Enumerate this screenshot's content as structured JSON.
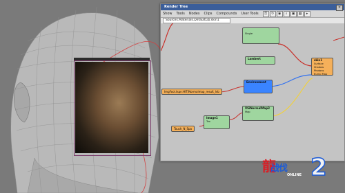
{
  "window": {
    "title": "Render Tree",
    "close_glyph": "×",
    "menus": [
      "Show",
      "Tools",
      "Nodes",
      "Clips",
      "Compounds",
      "User Tools"
    ],
    "path": "Sources.Materials.DefaultLib.skin1"
  },
  "nodes": {
    "top": {
      "label": "",
      "sub": "Single"
    },
    "lambert": {
      "label": "Lambert"
    },
    "environment": {
      "label": "Environment"
    },
    "phong_map": {
      "label": "XSiNormalMap3",
      "sub": "Map"
    },
    "image": {
      "label": "Image1",
      "sub": "Tex"
    },
    "skin": {
      "label": "skin1",
      "sub": "Surface\nShadow\nPhotons\nBump Map"
    }
  },
  "chips": {
    "left_mid": "ImgFool.tspn:HIT/Normalmap_result_lvb",
    "left_bottom": "Touch_N_Spa"
  },
  "colors": {
    "window_title": "#3b5e9a",
    "node_green": "#9fd69f",
    "node_blue": "#3a84ff",
    "node_orange": "#f5b05a",
    "wire_red": "#c8302a",
    "wire_yellow": "#f0d040",
    "wire_blue": "#3070f0"
  },
  "logo": {
    "red_char": "龍",
    "blue_text": "战伐",
    "sub": "ONLINE",
    "num": "2"
  }
}
